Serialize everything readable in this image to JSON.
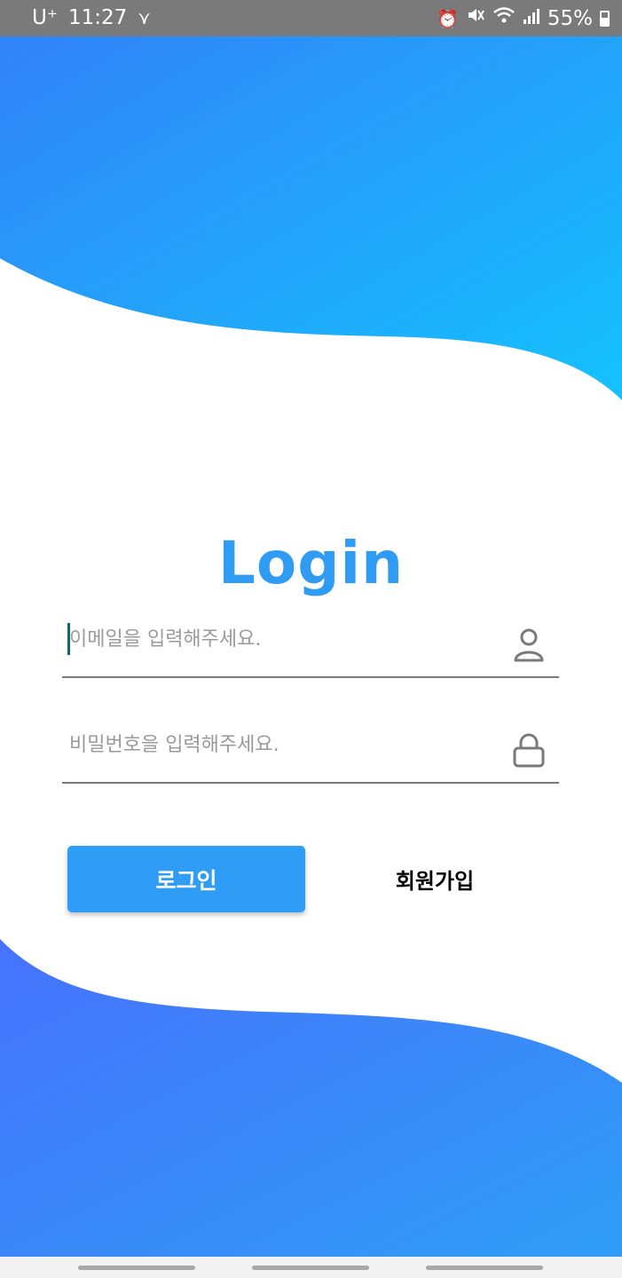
{
  "status_bar": {
    "carrier": "U⁺",
    "time": "11:27",
    "extra_icon": "V-icon",
    "battery": "55%",
    "icons": [
      "alarm-icon",
      "mute-icon",
      "wifi-icon",
      "signal-icon",
      "battery-icon"
    ]
  },
  "login": {
    "title": "Login",
    "email_placeholder": "이메일을 입력해주세요.",
    "password_placeholder": "비밀번호을 입력해주세요.",
    "login_button": "로그인",
    "signup_button": "회원가입"
  },
  "colors": {
    "title": "#2f9bf3",
    "button": "#2f9df5",
    "wave_top_start": "#3283f8",
    "wave_top_end": "#14c2fd",
    "wave_bottom_start": "#4672fd",
    "wave_bottom_end": "#2f9df5"
  }
}
